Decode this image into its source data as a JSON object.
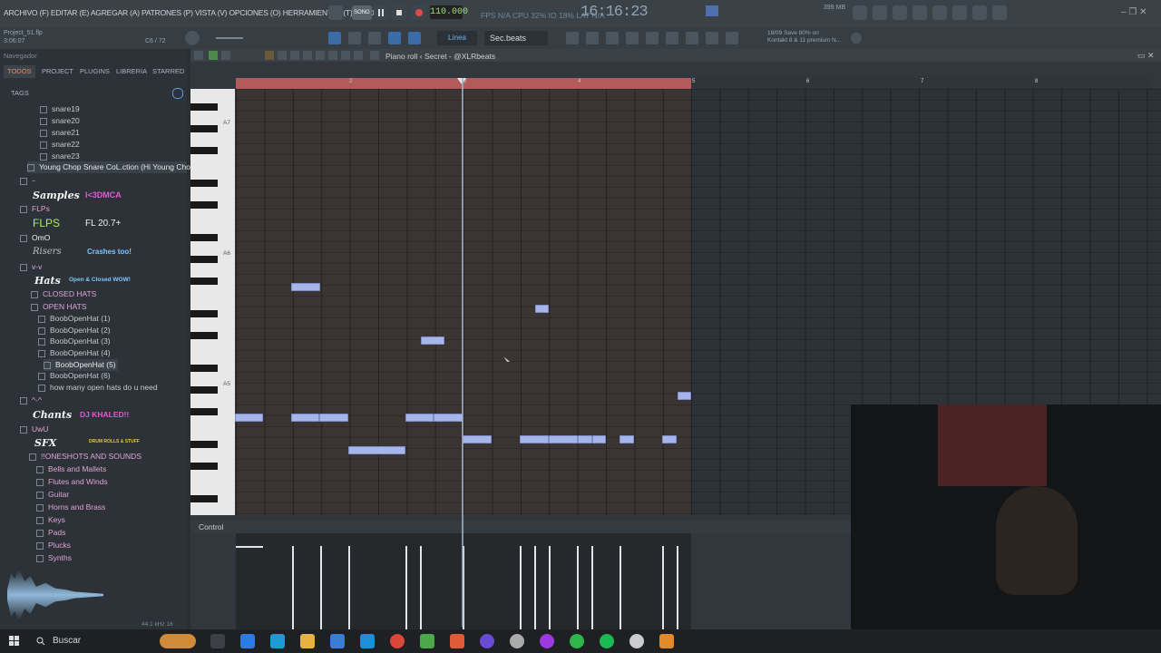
{
  "menu": {
    "text": "ARCHIVO (F) EDITAR (E) AGREGAR (A) PATRONES (P) VISTA (V) OPCIONES (O) HERRAMIENTAS (T) AYUDA",
    "tempo": "110.000",
    "song_mode": "SONG",
    "clock": "16:16:23",
    "cpu_status": "FPS N/A   CPU 32%   IO 18%   LAT N/A",
    "memory": "399 MB"
  },
  "bar2": {
    "project_name": "Project_51.flp",
    "project_time": "3:06:07",
    "ratio": "C6 / 72",
    "snap": "Línea",
    "pattern": "Sec.beats",
    "hint_line1": "18/09  Save 80% on",
    "hint_line2": "Kontakt 8 & 11 premium N..."
  },
  "browser": {
    "nav": "Navegador",
    "tabs": [
      "TODOS",
      "PROJECT",
      "PLUGINS",
      "LIBRERIA",
      "STARRED"
    ],
    "tags_label": "TAGS",
    "items": [
      {
        "label": "snare19",
        "type": "file"
      },
      {
        "label": "snare20",
        "type": "file"
      },
      {
        "label": "snare21",
        "type": "file"
      },
      {
        "label": "snare22",
        "type": "file"
      },
      {
        "label": "snare23",
        "type": "file"
      },
      {
        "label": "Young Chop Snare CoL.ction (Hi Young Chop)",
        "type": "folder"
      }
    ],
    "brands": {
      "samples": "Samples",
      "samples_tag": "I<3DMCA",
      "flps_folder": "FLPs",
      "flps_brand": "FLPS",
      "flps_tag": "FL 20.7+",
      "omo_folder": "OmO",
      "risers": "Risers",
      "risers_tag": "Crashes too!",
      "vv_folder": "v-v",
      "hats": "Hats",
      "hats_tag": "Open & Closed WOW!",
      "chants": "Chants",
      "chants_tag": "DJ KHALED!!",
      "uwu_folder": "UwU",
      "sfx": "SFX",
      "sfx_tag": "DRUM ROLLS & STUFF",
      "caret_folder": "^-^"
    },
    "hat_items": [
      {
        "label": "CLOSED HATS",
        "type": "folder"
      },
      {
        "label": "OPEN HATS",
        "type": "folder"
      },
      {
        "label": "BoobOpenHat (1)",
        "type": "file"
      },
      {
        "label": "BoobOpenHat (2)",
        "type": "file"
      },
      {
        "label": "BoobOpenHat (3)",
        "type": "file"
      },
      {
        "label": "BoobOpenHat (4)",
        "type": "file"
      },
      {
        "label": "BoobOpenHat (5)",
        "type": "file"
      },
      {
        "label": "BoobOpenHat (6)",
        "type": "file"
      },
      {
        "label": "how many open hats do u need",
        "type": "file"
      }
    ],
    "sfx_items": [
      {
        "label": "!!ONESHOTS AND SOUNDS",
        "type": "folder"
      },
      {
        "label": "Bells and Mallets",
        "type": "folder"
      },
      {
        "label": "Flutes and Winds",
        "type": "folder"
      },
      {
        "label": "Guitar",
        "type": "folder"
      },
      {
        "label": "Horns and Brass",
        "type": "folder"
      },
      {
        "label": "Keys",
        "type": "folder"
      },
      {
        "label": "Pads",
        "type": "folder"
      },
      {
        "label": "Plucks",
        "type": "folder"
      },
      {
        "label": "Synths",
        "type": "folder"
      }
    ],
    "sample_info": "44.1 kHz 16"
  },
  "piano_roll": {
    "title": "Piano roll  ‹  Secret - @XLRbeats",
    "bar_numbers": [
      "2",
      "3",
      "4",
      "5",
      "6",
      "7",
      "8"
    ],
    "octaves": [
      "A7",
      "A6",
      "A5"
    ],
    "control_label": "Control"
  },
  "taskbar": {
    "search_placeholder": "Buscar"
  }
}
